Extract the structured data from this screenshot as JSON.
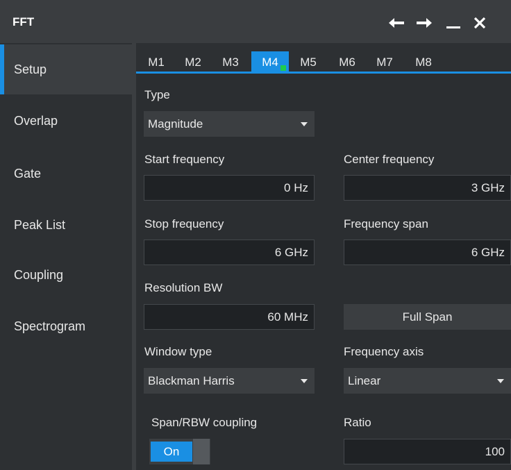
{
  "window": {
    "title": "FFT",
    "back_icon": "arrow-left-icon",
    "forward_icon": "arrow-right-icon",
    "minimize_icon": "minimize-icon",
    "close_icon": "close-icon"
  },
  "sidebar": {
    "items": [
      {
        "label": "Setup",
        "active": true
      },
      {
        "label": "Overlap",
        "active": false
      },
      {
        "label": "Gate",
        "active": false
      },
      {
        "label": "Peak List",
        "active": false
      },
      {
        "label": "Coupling",
        "active": false
      },
      {
        "label": "Spectrogram",
        "active": false
      }
    ]
  },
  "tabs": {
    "items": [
      "M1",
      "M2",
      "M3",
      "M4",
      "M5",
      "M6",
      "M7",
      "M8"
    ],
    "active": "M4"
  },
  "form": {
    "type_label": "Type",
    "type_value": "Magnitude",
    "start_freq_label": "Start frequency",
    "start_freq_value": "0 Hz",
    "center_freq_label": "Center frequency",
    "center_freq_value": "3 GHz",
    "stop_freq_label": "Stop frequency",
    "stop_freq_value": "6 GHz",
    "span_label": "Frequency span",
    "span_value": "6 GHz",
    "rbw_label": "Resolution BW",
    "rbw_value": "60 MHz",
    "full_span_label": "Full Span",
    "window_type_label": "Window type",
    "window_type_value": "Blackman Harris",
    "freq_axis_label": "Frequency axis",
    "freq_axis_value": "Linear",
    "coupling_label": "Span/RBW coupling",
    "coupling_value": "On",
    "ratio_label": "Ratio",
    "ratio_value": "100"
  },
  "colors": {
    "accent": "#1a8fe3",
    "indicator": "#1fcc4b"
  }
}
